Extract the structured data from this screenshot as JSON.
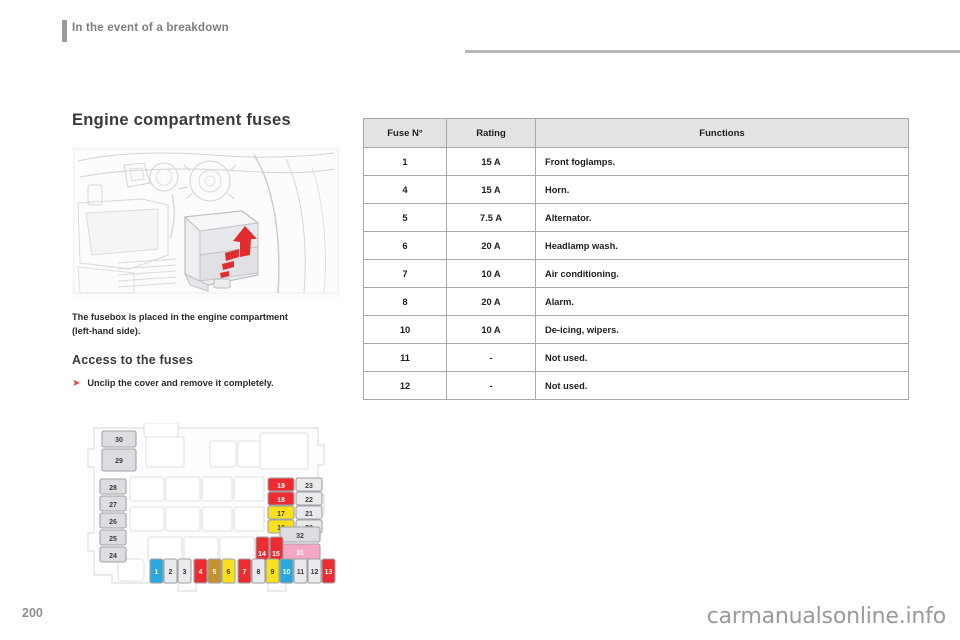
{
  "header": {
    "title": "In the event of a breakdown"
  },
  "left": {
    "section_title": "Engine compartment fuses",
    "intro_paragraph": "The fusebox is placed in the engine compartment (left-hand side).",
    "access_heading": "Access to the fuses",
    "bullet_glyph": "➤",
    "bullet_text": "Unclip the cover and remove it completely.",
    "illustration_name": "engine-bay-fusebox-location"
  },
  "table": {
    "headers": [
      "Fuse N°",
      "Rating",
      "Functions"
    ],
    "rows": [
      {
        "fuse": "1",
        "rating": "15 A",
        "function": "Front foglamps."
      },
      {
        "fuse": "4",
        "rating": "15 A",
        "function": "Horn."
      },
      {
        "fuse": "5",
        "rating": "7.5 A",
        "function": "Alternator."
      },
      {
        "fuse": "6",
        "rating": "20 A",
        "function": "Headlamp wash."
      },
      {
        "fuse": "7",
        "rating": "10 A",
        "function": "Air conditioning."
      },
      {
        "fuse": "8",
        "rating": "20 A",
        "function": "Alarm."
      },
      {
        "fuse": "10",
        "rating": "10 A",
        "function": "De-icing, wipers."
      },
      {
        "fuse": "11",
        "rating": "-",
        "function": "Not used."
      },
      {
        "fuse": "12",
        "rating": "-",
        "function": "Not used."
      }
    ]
  },
  "fusebox_diagram": {
    "fuse_colors": {
      "blue": "#29a8dc",
      "grey": "#e9eaec",
      "red": "#ee2b30",
      "brown": "#c4922e",
      "yellow": "#f9e01c",
      "pink": "#f4a7c4",
      "relay_grey": "#dcdde0"
    },
    "bottom_row": [
      {
        "label": "1",
        "color": "blue"
      },
      {
        "label": "2",
        "color": "grey"
      },
      {
        "label": "3",
        "color": "grey"
      },
      {
        "label": "4",
        "color": "red"
      },
      {
        "label": "5",
        "color": "brown"
      },
      {
        "label": "6",
        "color": "yellow"
      },
      {
        "label": "7",
        "color": "red"
      },
      {
        "label": "8",
        "color": "grey"
      },
      {
        "label": "9",
        "color": "yellow"
      },
      {
        "label": "10",
        "color": "blue"
      },
      {
        "label": "11",
        "color": "grey"
      },
      {
        "label": "12",
        "color": "grey"
      },
      {
        "label": "13",
        "color": "red"
      }
    ],
    "tall_pair": [
      {
        "label": "14",
        "color": "red"
      },
      {
        "label": "15",
        "color": "red"
      }
    ],
    "right_grid": [
      {
        "label": "19",
        "color": "red"
      },
      {
        "label": "23",
        "color": "grey"
      },
      {
        "label": "18",
        "color": "red"
      },
      {
        "label": "22",
        "color": "grey"
      },
      {
        "label": "17",
        "color": "yellow"
      },
      {
        "label": "21",
        "color": "grey"
      },
      {
        "label": "16",
        "color": "yellow"
      },
      {
        "label": "20",
        "color": "grey"
      }
    ],
    "right_lower": [
      {
        "label": "32",
        "color": "relay_grey"
      },
      {
        "label": "31",
        "color": "pink"
      }
    ],
    "left_column": [
      {
        "label": "30",
        "color": "relay_grey"
      },
      {
        "label": "29",
        "color": "relay_grey"
      },
      {
        "label": "28",
        "color": "relay_grey"
      },
      {
        "label": "27",
        "color": "relay_grey"
      },
      {
        "label": "26",
        "color": "relay_grey"
      },
      {
        "label": "25",
        "color": "relay_grey"
      },
      {
        "label": "24",
        "color": "relay_grey"
      }
    ]
  },
  "footer": {
    "page_number": "200",
    "watermark": "carmanualsonline.info"
  }
}
